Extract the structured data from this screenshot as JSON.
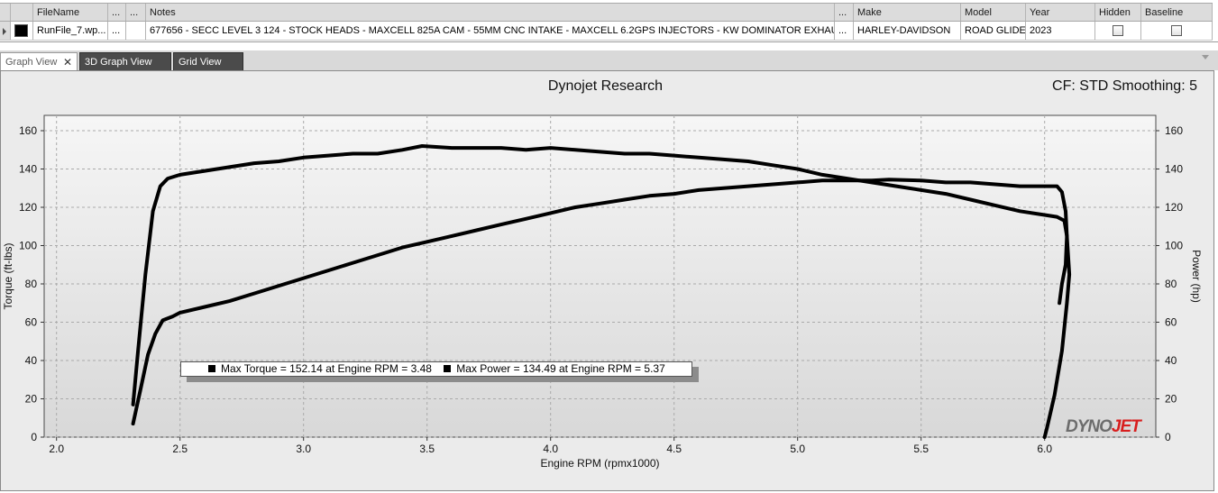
{
  "table": {
    "headers": {
      "filename": "FileName",
      "dots1": "...",
      "dots2": "...",
      "notes": "Notes",
      "dots3": "...",
      "make": "Make",
      "model": "Model",
      "year": "Year",
      "hidden": "Hidden",
      "baseline": "Baseline"
    },
    "row": {
      "swatch_color": "#000000",
      "filename": "RunFile_7.wp...",
      "dots1": "...",
      "dots2": "",
      "notes": "677656 - SECC LEVEL 3 124 - STOCK HEADS - MAXCELL 825A CAM - 55MM CNC INTAKE - MAXCELL 6.2GPS INJECTORS - KW DOMINATOR EXHAUST - TTS",
      "dots3": "...",
      "make": "HARLEY-DAVIDSON",
      "model": "ROAD GLIDE",
      "year": "2023",
      "hidden": false,
      "baseline": false
    }
  },
  "tabs": [
    {
      "label": "Graph View",
      "active": true,
      "close": "✕"
    },
    {
      "label": "3D Graph View",
      "active": false
    },
    {
      "label": "Grid View",
      "active": false
    }
  ],
  "graph": {
    "title": "Dynojet Research",
    "cf_label": "CF: STD Smoothing: 5",
    "watermark_a": "DYNO",
    "watermark_b": "JET",
    "legend": {
      "max_torque": "Max Torque = 152.14 at Engine RPM = 3.48",
      "max_power": "Max Power = 134.49 at Engine RPM = 5.37"
    }
  },
  "chart_data": {
    "type": "line",
    "xlabel": "Engine RPM (rpmx1000)",
    "ylabel": "Torque (ft-lbs)",
    "y2label": "Power (hp)",
    "xlim": [
      1.95,
      6.45
    ],
    "ylim": [
      0,
      168
    ],
    "y2lim": [
      0,
      168
    ],
    "x_ticks": [
      "2.0",
      "2.5",
      "3.0",
      "3.5",
      "4.0",
      "4.5",
      "5.0",
      "5.5",
      "6.0"
    ],
    "y_ticks": [
      "0",
      "20",
      "40",
      "60",
      "80",
      "100",
      "120",
      "140",
      "160"
    ],
    "grid": true,
    "line_color": "#000000",
    "series": [
      {
        "name": "Torque",
        "axis": "left",
        "x": [
          2.31,
          2.33,
          2.36,
          2.39,
          2.42,
          2.45,
          2.5,
          2.6,
          2.7,
          2.8,
          2.9,
          3.0,
          3.1,
          3.2,
          3.3,
          3.4,
          3.48,
          3.6,
          3.7,
          3.8,
          3.9,
          4.0,
          4.1,
          4.2,
          4.3,
          4.4,
          4.5,
          4.6,
          4.7,
          4.8,
          4.9,
          5.0,
          5.1,
          5.2,
          5.3,
          5.4,
          5.5,
          5.6,
          5.7,
          5.8,
          5.9,
          6.0,
          6.05,
          6.08,
          6.09,
          6.1,
          6.09,
          6.07,
          6.04,
          6.01,
          6.0
        ],
        "y": [
          17,
          45,
          85,
          118,
          131,
          135,
          137,
          139,
          141,
          143,
          144,
          146,
          147,
          148,
          148,
          150,
          152,
          151,
          151,
          151,
          150,
          151,
          150,
          149,
          148,
          148,
          147,
          146,
          145,
          144,
          142,
          140,
          137,
          135,
          133,
          131,
          129,
          127,
          124,
          121,
          118,
          116,
          115,
          113,
          105,
          85,
          70,
          45,
          22,
          5,
          0
        ]
      },
      {
        "name": "Power",
        "axis": "right",
        "x": [
          2.31,
          2.34,
          2.37,
          2.4,
          2.43,
          2.47,
          2.5,
          2.6,
          2.7,
          2.8,
          2.9,
          3.0,
          3.1,
          3.2,
          3.3,
          3.4,
          3.5,
          3.6,
          3.7,
          3.8,
          3.9,
          4.0,
          4.1,
          4.2,
          4.3,
          4.4,
          4.5,
          4.6,
          4.7,
          4.8,
          4.9,
          5.0,
          5.1,
          5.2,
          5.3,
          5.37,
          5.5,
          5.6,
          5.7,
          5.8,
          5.9,
          6.0,
          6.05,
          6.07,
          6.085,
          6.09,
          6.085,
          6.07,
          6.06
        ],
        "y": [
          7,
          25,
          43,
          54,
          61,
          63,
          65,
          68,
          71,
          75,
          79,
          83,
          87,
          91,
          95,
          99,
          102,
          105,
          108,
          111,
          114,
          117,
          120,
          122,
          124,
          126,
          127,
          129,
          130,
          131,
          132,
          133,
          134,
          134,
          134,
          134.5,
          134,
          133,
          133,
          132,
          131,
          131,
          131,
          128,
          118,
          105,
          90,
          80,
          70
        ]
      }
    ]
  }
}
